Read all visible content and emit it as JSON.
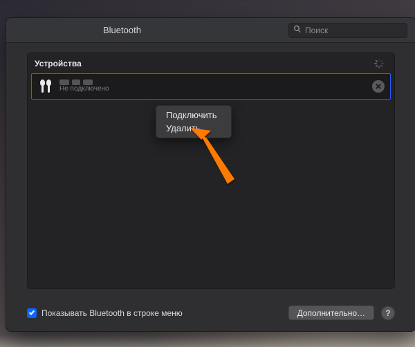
{
  "titlebar": {
    "title": "Bluetooth",
    "search_placeholder": "Поиск"
  },
  "panel": {
    "title": "Устройства"
  },
  "device": {
    "status": "Не подключено"
  },
  "context_menu": {
    "connect": "Подключить",
    "remove": "Удалить"
  },
  "footer": {
    "show_in_menu": "Показывать Bluetooth в строке меню",
    "advanced": "Дополнительно…",
    "help": "?"
  }
}
